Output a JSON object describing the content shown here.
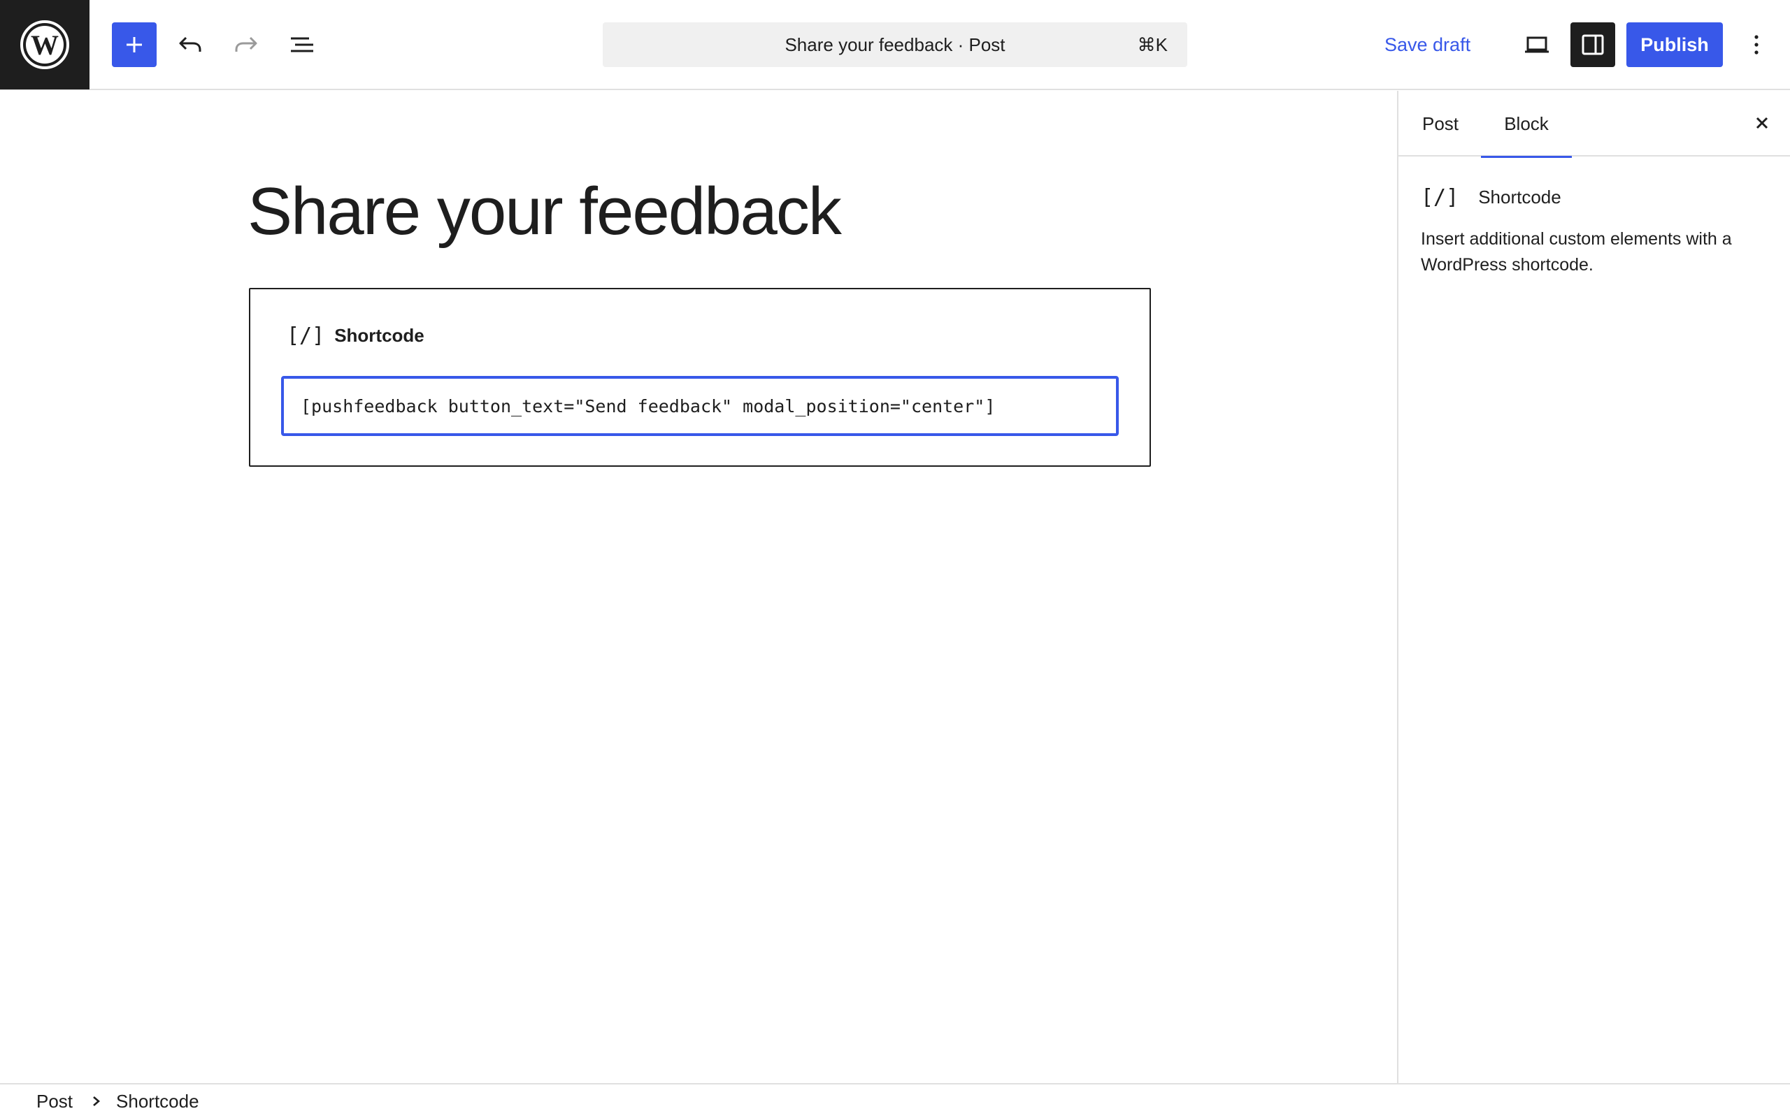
{
  "header": {
    "logo_icon": "wordpress-logo-icon",
    "add_block_icon": "plus-icon",
    "undo_icon": "undo-icon",
    "redo_icon": "redo-icon",
    "list_view_icon": "list-view-icon",
    "command_bar": {
      "title": "Share your feedback · Post",
      "shortcut": "⌘K"
    },
    "save_draft_label": "Save draft",
    "preview_icon": "desktop-icon",
    "settings_icon": "sidebar-toggle-icon",
    "publish_label": "Publish",
    "more_icon": "more-vertical-icon"
  },
  "editor": {
    "post_title": "Share your feedback",
    "shortcode_block": {
      "icon": "[/]",
      "label": "Shortcode",
      "value": "[pushfeedback button_text=\"Send feedback\" modal_position=\"center\"]"
    }
  },
  "sidebar": {
    "tabs": [
      {
        "label": "Post",
        "active": false
      },
      {
        "label": "Block",
        "active": true
      }
    ],
    "close_icon": "close-icon",
    "block": {
      "icon": "[/]",
      "name": "Shortcode",
      "description": "Insert additional custom elements with a WordPress shortcode."
    }
  },
  "breadcrumb": {
    "items": [
      "Post",
      "Shortcode"
    ],
    "separator_icon": "chevron-right-icon"
  },
  "colors": {
    "accent": "#3858e9",
    "dark": "#1e1e1e",
    "border": "#e0e0e0",
    "command_bg": "#f0f0f0"
  }
}
